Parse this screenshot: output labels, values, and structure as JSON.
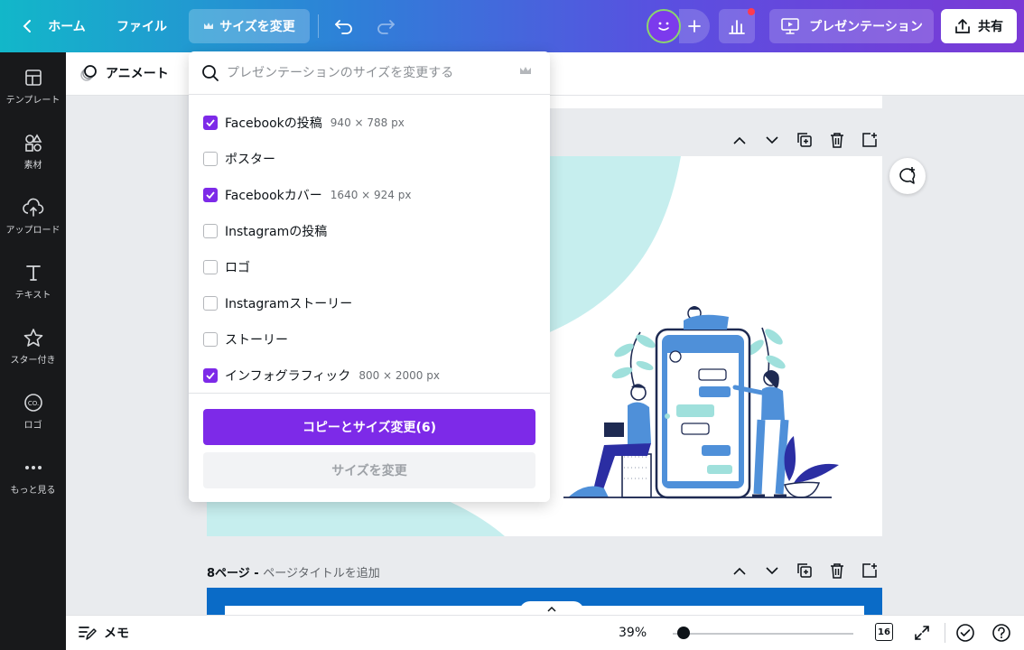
{
  "topbar": {
    "home_label": "ホーム",
    "file_label": "ファイル",
    "resize_label": "サイズを変更",
    "present_label": "プレゼンテーション",
    "share_label": "共有"
  },
  "sidebar": {
    "items": [
      {
        "label": "テンプレート",
        "icon": "templates-icon"
      },
      {
        "label": "素材",
        "icon": "elements-icon"
      },
      {
        "label": "アップロード",
        "icon": "upload-icon"
      },
      {
        "label": "テキスト",
        "icon": "text-icon"
      },
      {
        "label": "スター付き",
        "icon": "star-icon"
      },
      {
        "label": "ロゴ",
        "icon": "logo-icon"
      },
      {
        "label": "もっと見る",
        "icon": "more-icon"
      }
    ]
  },
  "subbar": {
    "animate_label": "アニメート"
  },
  "resize_dropdown": {
    "search_placeholder": "プレゼンテーションのサイズを変更する",
    "options": [
      {
        "label": "Facebookの投稿",
        "dims": "940 × 788 px",
        "checked": true
      },
      {
        "label": "ポスター",
        "dims": "",
        "checked": false
      },
      {
        "label": "Facebookカバー",
        "dims": "1640 × 924 px",
        "checked": true
      },
      {
        "label": "Instagramの投稿",
        "dims": "",
        "checked": false
      },
      {
        "label": "ロゴ",
        "dims": "",
        "checked": false
      },
      {
        "label": "Instagramストーリー",
        "dims": "",
        "checked": false
      },
      {
        "label": "ストーリー",
        "dims": "",
        "checked": false
      },
      {
        "label": "インフォグラフィック",
        "dims": "800 × 2000 px",
        "checked": true
      }
    ],
    "copy_resize_label": "コピーとサイズ変更(6)",
    "resize_label": "サイズを変更"
  },
  "canvas": {
    "page8_title_prefix": "8ページ - ",
    "page8_title_placeholder": "ページタイトルを追加"
  },
  "bottombar": {
    "memo_label": "メモ",
    "zoom": "39%",
    "zoom_level": 0.06,
    "page_count": "16"
  },
  "colors": {
    "accent": "#7d2ae8",
    "sidebar_bg": "#18191b",
    "teal_shape": "#c6eeee"
  }
}
